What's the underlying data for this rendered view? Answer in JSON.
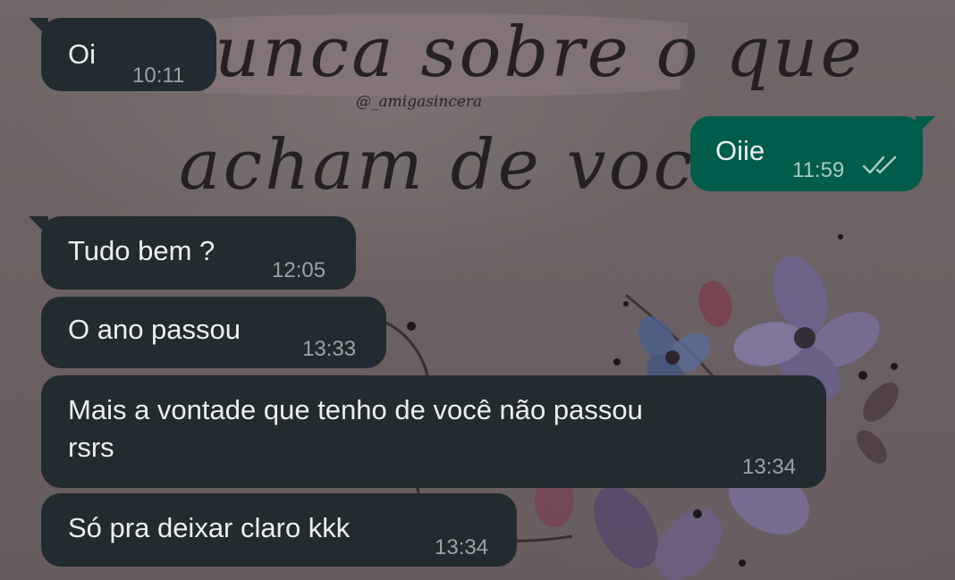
{
  "wallpaper": {
    "line1": "unca sobre o que",
    "handle": "@_amigasincera",
    "line2": "acham de você"
  },
  "messages": [
    {
      "direction": "incoming",
      "text": "Oi",
      "time": "10:11"
    },
    {
      "direction": "outgoing",
      "text": "Oiie",
      "time": "11:59",
      "status": "read-ticks-icon"
    },
    {
      "direction": "incoming",
      "text": "Tudo bem ?",
      "time": "12:05"
    },
    {
      "direction": "incoming",
      "text": "O ano passou",
      "time": "13:33"
    },
    {
      "direction": "incoming",
      "text_line1": "Mais a vontade que tenho de você não passou",
      "text_line2": "rsrs",
      "time": "13:34"
    },
    {
      "direction": "incoming",
      "text": "Só pra deixar claro kkk",
      "time": "13:34"
    }
  ],
  "colors": {
    "incoming_bubble": "#222b2f",
    "outgoing_bubble": "#005c4b",
    "read_ticks": "#a9c9c0"
  }
}
